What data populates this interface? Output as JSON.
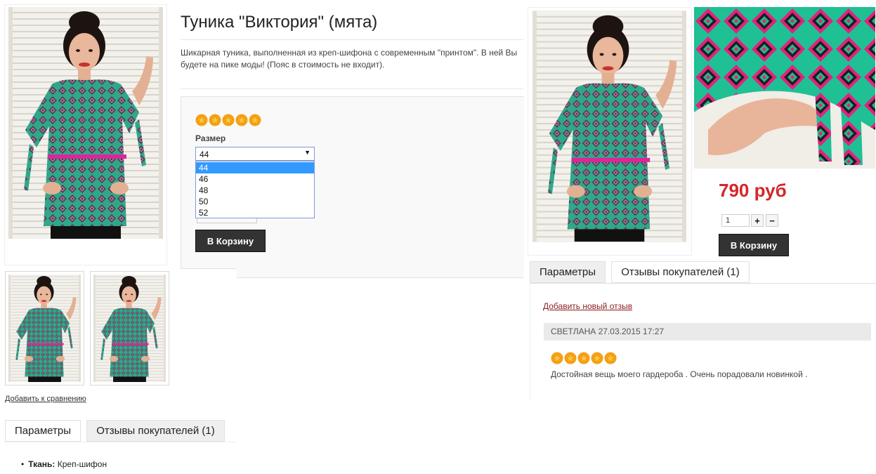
{
  "product": {
    "title": "Туника \"Виктория\" (мята)",
    "description": "Шикарная туника, выполненная из креп-шифона с современным \"принтом\". В ней Вы будете на пике моды! (Пояс в стоимость не входит).",
    "rating_stars": 5,
    "size_label": "Размер",
    "size_selected": "44",
    "size_options": [
      "44",
      "46",
      "48",
      "50",
      "52"
    ],
    "cart_button": "В Корзину",
    "compare_link": "Добавить к сравнению",
    "images": [
      "main-photo",
      "thumb-1",
      "thumb-2"
    ]
  },
  "tabs": {
    "params": "Параметры",
    "reviews": "Отзывы покупателей (1)"
  },
  "params": {
    "fabric_label": "Ткань:",
    "fabric_value": "Креп-шифон"
  },
  "popup": {
    "price": "790 руб",
    "qty": "1",
    "plus": "+",
    "minus": "−",
    "cart_button": "В Корзину",
    "tabs": {
      "params": "Параметры",
      "reviews": "Отзывы покупателей (1)"
    },
    "add_review_link": "Добавить новый отзыв",
    "review": {
      "header": "СВЕТЛАНА 27.03.2015 17:27",
      "stars": 5,
      "text": "Достойная вещь моего гардероба . Очень порадовали новинкой ."
    }
  },
  "colors": {
    "price": "#d4262a",
    "star": "#f5a21a",
    "button": "#333333",
    "belt": "#e0239a",
    "fabric": "#2fa889"
  }
}
